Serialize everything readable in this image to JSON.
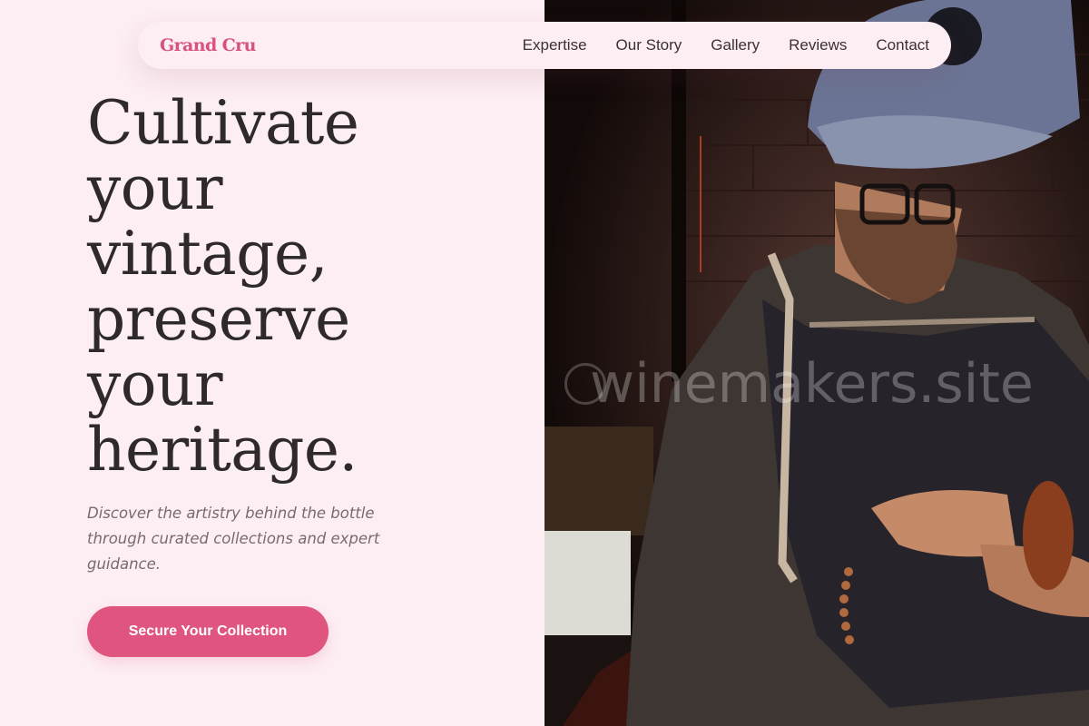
{
  "brand": {
    "name": "Grand Cru"
  },
  "nav": {
    "items": [
      {
        "label": "Expertise"
      },
      {
        "label": "Our Story"
      },
      {
        "label": "Gallery"
      },
      {
        "label": "Reviews"
      },
      {
        "label": "Contact"
      }
    ]
  },
  "hero": {
    "headline_lines": [
      "Cultivate",
      "your",
      "vintage,",
      "preserve",
      "your",
      "heritage."
    ],
    "subtext": "Discover the artistry behind the bottle through curated collections and expert guidance.",
    "cta_label": "Secure Your Collection"
  },
  "photo": {
    "watermark": "winemakers.site",
    "subject": "winemaker-with-cap-glasses-and-apron"
  },
  "colors": {
    "accent": "#e0557f",
    "brand": "#d9517f",
    "background": "#fdeef3",
    "text_dark": "#2e2a2c",
    "text_muted": "#776b70"
  }
}
